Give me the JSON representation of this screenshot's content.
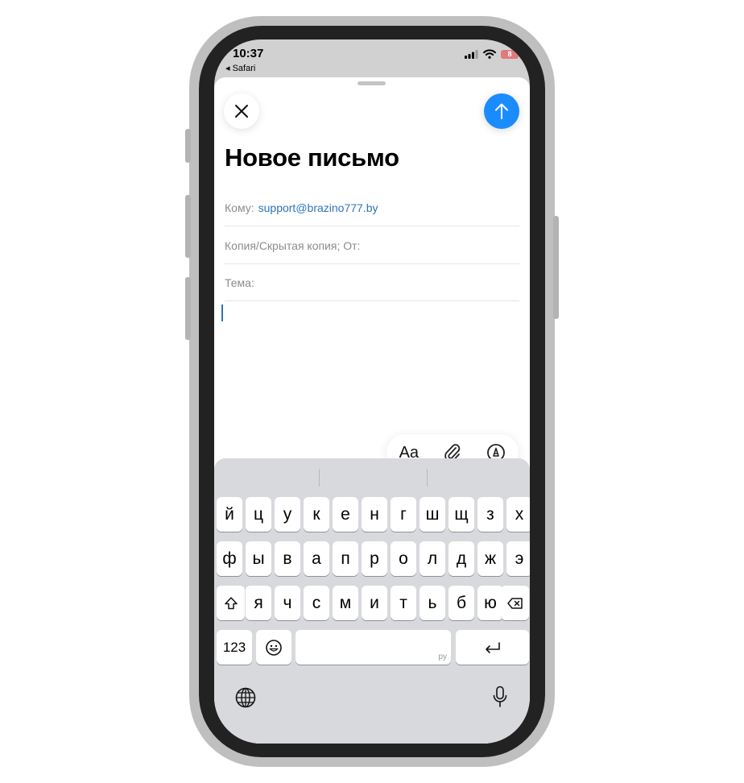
{
  "status_bar": {
    "time": "10:37",
    "back_app": "◂ Safari",
    "battery_level": "8"
  },
  "compose": {
    "title": "Новое письмо",
    "to_label": "Кому:",
    "to_value": "support@brazino777.by",
    "cc_label": "Копия/Скрытая копия; От:",
    "subject_label": "Тема:",
    "subject_value": "",
    "body": ""
  },
  "format_bar": {
    "text_style_label": "Aa"
  },
  "keyboard": {
    "language": "ру",
    "row1": [
      "й",
      "ц",
      "у",
      "к",
      "е",
      "н",
      "г",
      "ш",
      "щ",
      "з",
      "х"
    ],
    "row2": [
      "ф",
      "ы",
      "в",
      "а",
      "п",
      "р",
      "о",
      "л",
      "д",
      "ж",
      "э"
    ],
    "row3": [
      "я",
      "ч",
      "с",
      "м",
      "и",
      "т",
      "ь",
      "б",
      "ю"
    ],
    "numbers_label": "123"
  },
  "colors": {
    "accent": "#1a8cff",
    "link": "#2d74b9",
    "keyboard_bg": "#d8d9dd"
  },
  "icons": [
    "close-icon",
    "send-arrow-icon",
    "attachment-icon",
    "markup-icon",
    "shift-icon",
    "backspace-icon",
    "emoji-icon",
    "return-icon",
    "globe-icon",
    "microphone-icon",
    "wifi-icon",
    "signal-icon",
    "battery-icon"
  ]
}
